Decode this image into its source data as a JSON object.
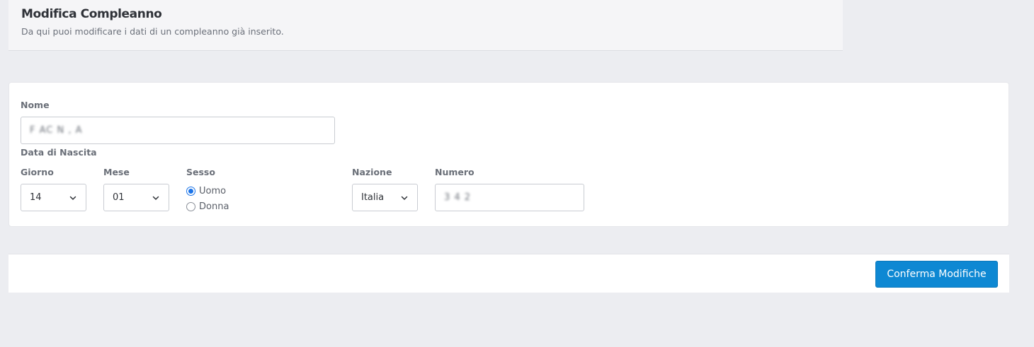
{
  "header": {
    "title": "Modifica Compleanno",
    "subtitle": "Da qui puoi modificare i dati di un compleanno già inserito."
  },
  "form": {
    "name_label": "Nome",
    "name_value": "F  AC  N  ,  A",
    "birth_label": "Data di Nascita",
    "day_label": "Giorno",
    "day_value": "14",
    "month_label": "Mese",
    "month_value": "01",
    "sex_label": "Sesso",
    "sex_options": [
      "Uomo",
      "Donna"
    ],
    "nation_label": "Nazione",
    "nation_value": "Italia",
    "number_label": "Numero",
    "number_value": "3       4  2"
  },
  "footer": {
    "confirm_label": "Conferma Modifiche"
  },
  "colors": {
    "accent": "#0e88d3",
    "radio_checked": "#1a73e8",
    "background": "#ecedf1"
  }
}
